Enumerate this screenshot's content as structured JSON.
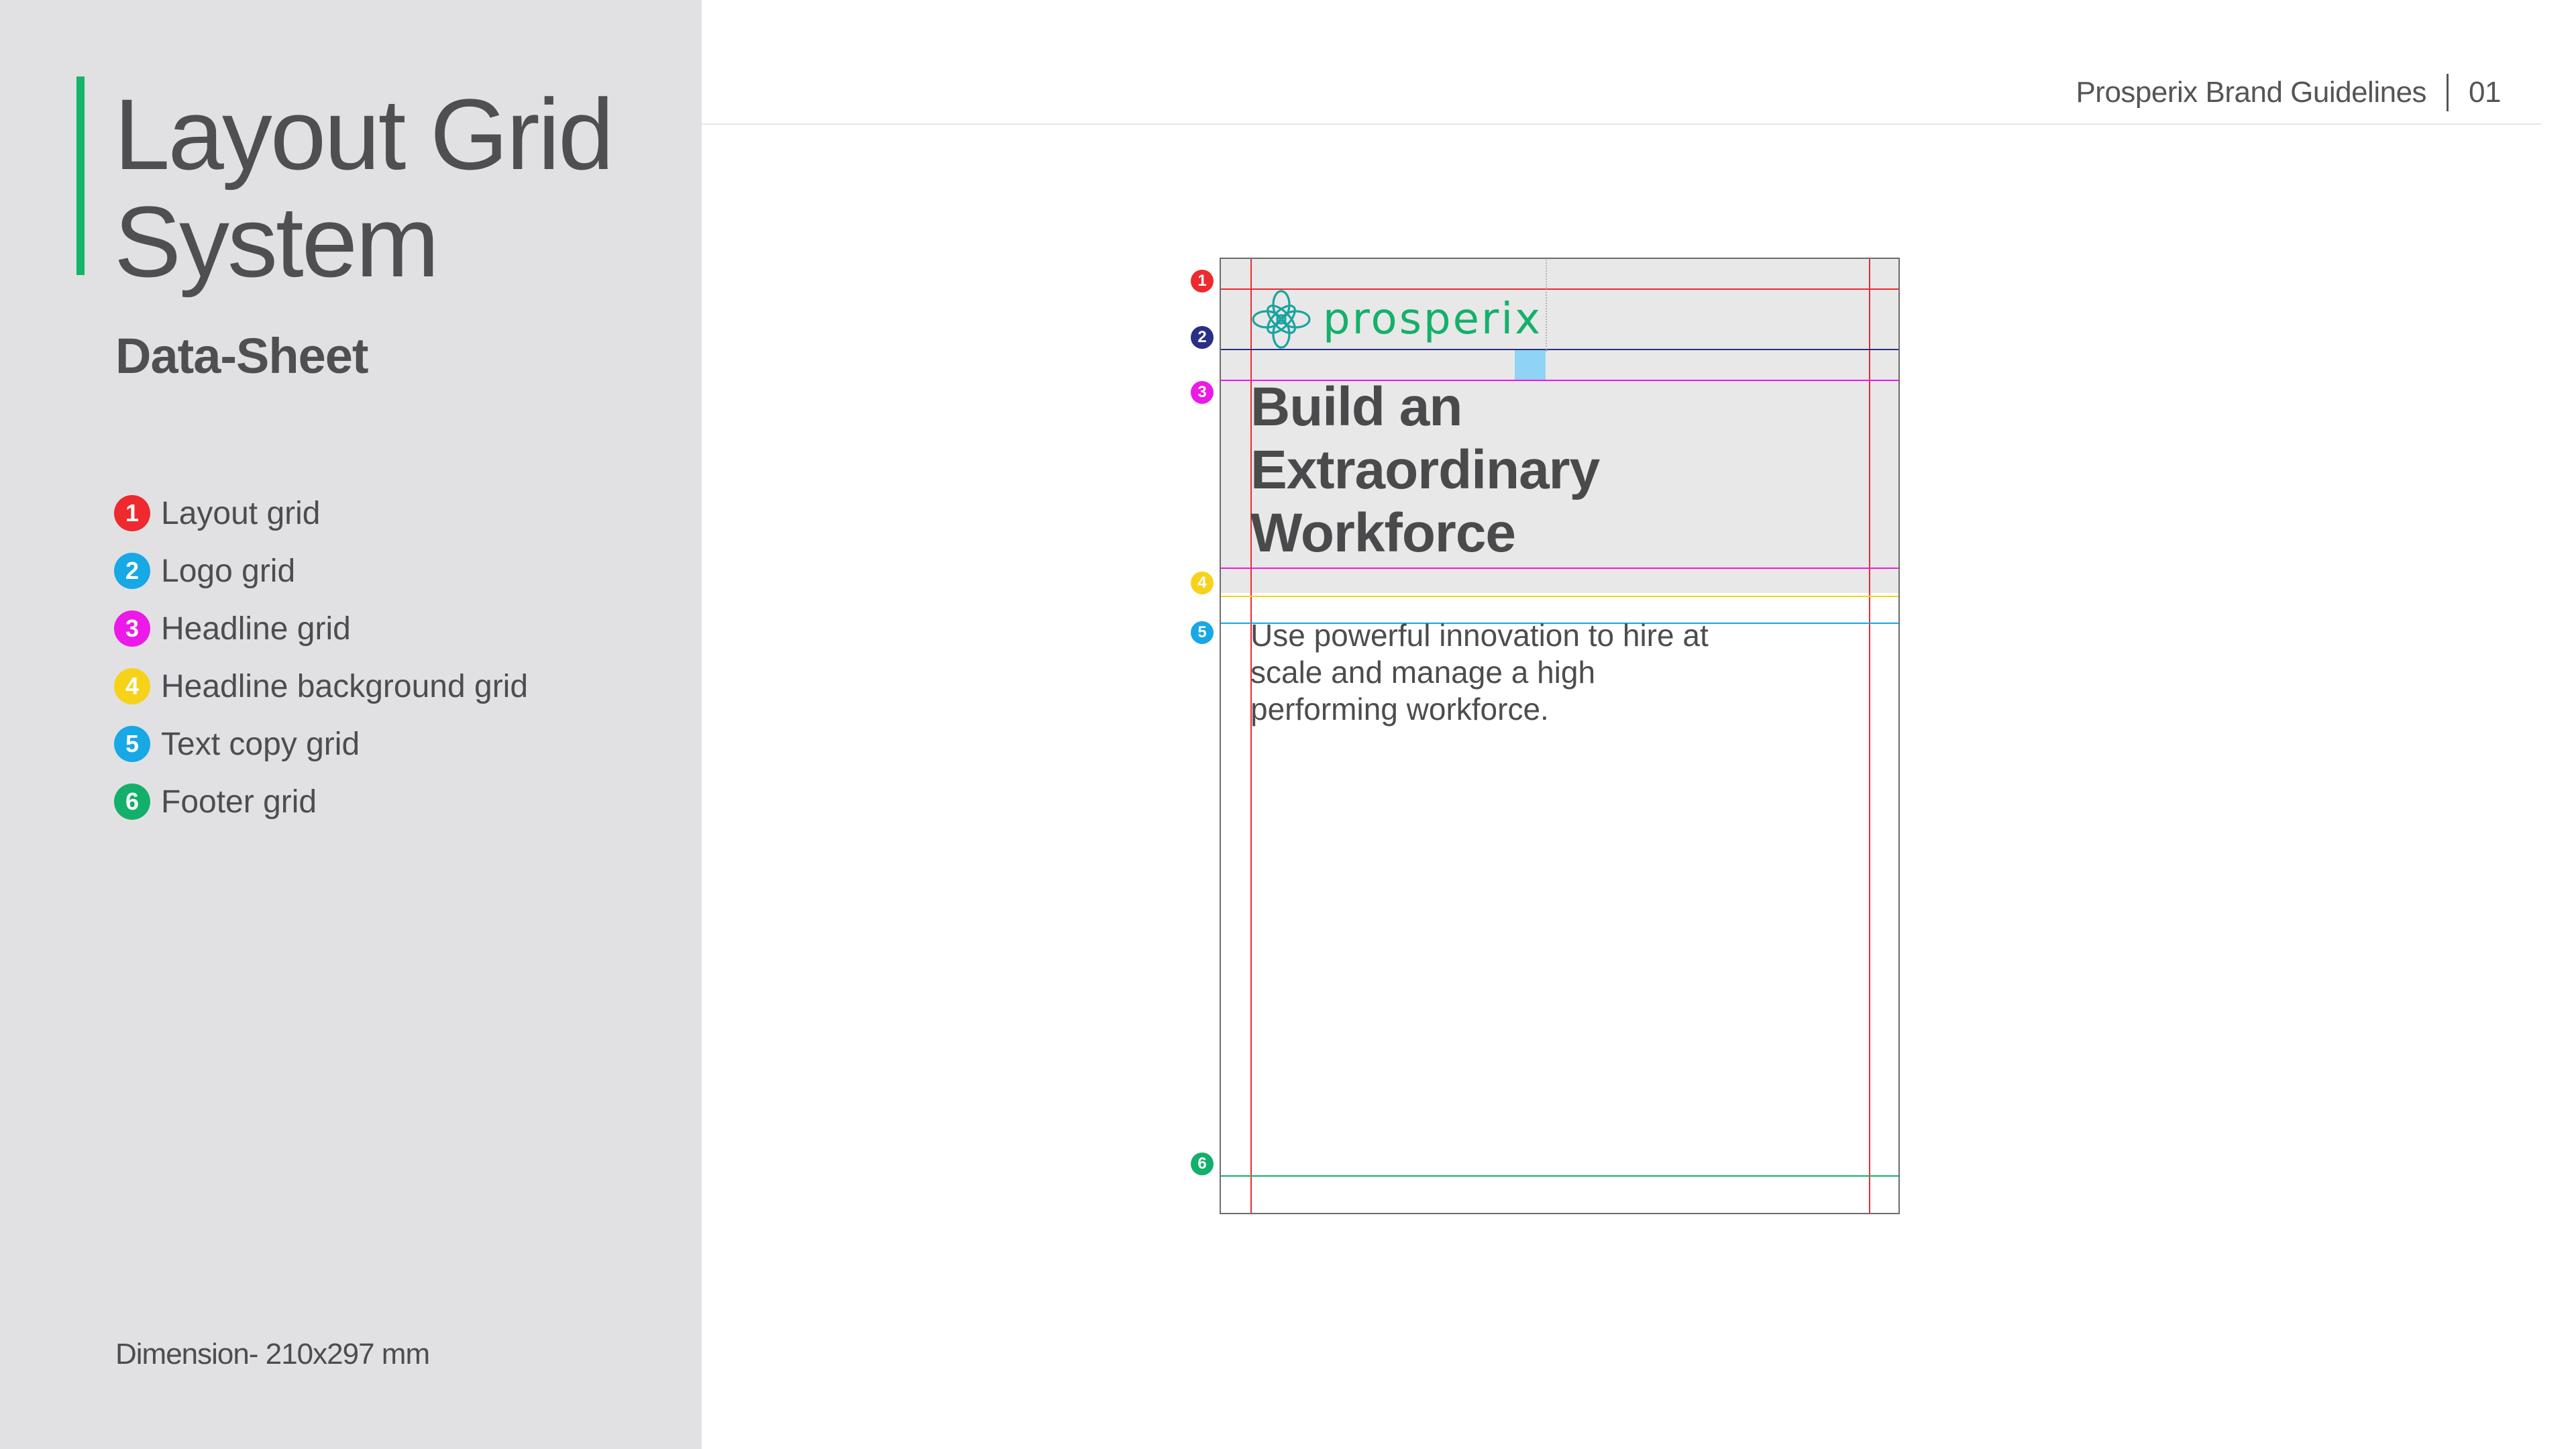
{
  "sidebar": {
    "title_line1": "Layout Grid",
    "title_line2": "System",
    "subtitle": "Data-Sheet",
    "legend": [
      {
        "number": "1",
        "label": "Layout grid",
        "color": "#ee2a2f"
      },
      {
        "number": "2",
        "label": "Logo grid",
        "color": "#17a8e6"
      },
      {
        "number": "3",
        "label": "Headline grid",
        "color": "#ec19e8"
      },
      {
        "number": "4",
        "label": "Headline background grid",
        "color": "#f7d21b"
      },
      {
        "number": "5",
        "label": "Text copy grid",
        "color": "#17a8e6"
      },
      {
        "number": "6",
        "label": "Footer grid",
        "color": "#12b06a"
      }
    ],
    "dimension": "Dimension- 210x297 mm"
  },
  "header": {
    "title": "Prosperix Brand Guidelines",
    "page_number": "01"
  },
  "document": {
    "logo_text": "prosperix",
    "headline_line1": "Build an",
    "headline_line2": "Extraordinary",
    "headline_line3": "Workforce",
    "body_line1": "Use powerful innovation to hire at",
    "body_line2": "scale and manage a high",
    "body_line3": "performing workforce.",
    "markers": [
      {
        "number": "1",
        "color": "#ee2a2f"
      },
      {
        "number": "2",
        "color": "#2b2f86"
      },
      {
        "number": "3",
        "color": "#ec19e8"
      },
      {
        "number": "4",
        "color": "#f7d21b"
      },
      {
        "number": "5",
        "color": "#17a8e6"
      },
      {
        "number": "6",
        "color": "#12b06a"
      }
    ]
  },
  "colors": {
    "accent": "#14b469",
    "sidebar_bg": "#e1e1e3",
    "logo_green": "#15b06b",
    "logo_teal": "#1aa3a0"
  }
}
